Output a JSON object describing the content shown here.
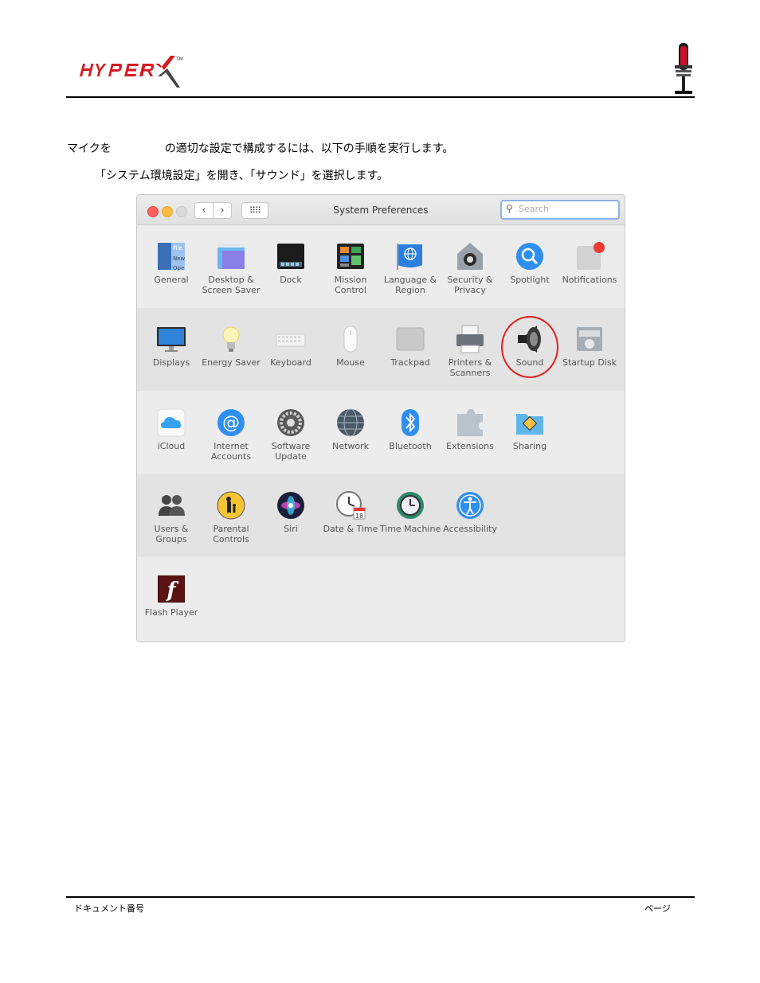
{
  "header": {
    "logo_text": "HyperX",
    "brand_color": "#d71920"
  },
  "instructions": {
    "line1_before": "マイクを",
    "line1_after": "の適切な設定で構成するには、以下の手順を実行します。",
    "line2": "「システム環境設定」を開き、「サウンド」を選択します。"
  },
  "window": {
    "title": "System Preferences",
    "search_placeholder": "Search",
    "back_glyph": "‹",
    "forward_glyph": "›",
    "grid_glyph": "⠿⠿",
    "rows": [
      [
        {
          "label": "General",
          "icon": "general-icon"
        },
        {
          "label": "Desktop & Screen Saver",
          "icon": "desktop-icon"
        },
        {
          "label": "Dock",
          "icon": "dock-icon"
        },
        {
          "label": "Mission Control",
          "icon": "mission-control-icon"
        },
        {
          "label": "Language & Region",
          "icon": "flag-icon"
        },
        {
          "label": "Security & Privacy",
          "icon": "house-lock-icon"
        },
        {
          "label": "Spotlight",
          "icon": "magnifier-icon"
        },
        {
          "label": "Notifications",
          "icon": "notifications-icon"
        }
      ],
      [
        {
          "label": "Displays",
          "icon": "monitor-icon"
        },
        {
          "label": "Energy Saver",
          "icon": "bulb-icon"
        },
        {
          "label": "Keyboard",
          "icon": "keyboard-icon"
        },
        {
          "label": "Mouse",
          "icon": "mouse-icon"
        },
        {
          "label": "Trackpad",
          "icon": "trackpad-icon"
        },
        {
          "label": "Printers & Scanners",
          "icon": "printer-icon"
        },
        {
          "label": "Sound",
          "icon": "speaker-icon"
        },
        {
          "label": "Startup Disk",
          "icon": "disk-icon"
        }
      ],
      [
        {
          "label": "iCloud",
          "icon": "cloud-icon"
        },
        {
          "label": "Internet Accounts",
          "icon": "at-icon"
        },
        {
          "label": "Software Update",
          "icon": "gear-icon"
        },
        {
          "label": "Network",
          "icon": "globe-icon"
        },
        {
          "label": "Bluetooth",
          "icon": "bluetooth-icon"
        },
        {
          "label": "Extensions",
          "icon": "puzzle-icon"
        },
        {
          "label": "Sharing",
          "icon": "sharing-folder-icon"
        }
      ],
      [
        {
          "label": "Users & Groups",
          "icon": "users-icon"
        },
        {
          "label": "Parental Controls",
          "icon": "parental-icon"
        },
        {
          "label": "Siri",
          "icon": "siri-icon"
        },
        {
          "label": "Date & Time",
          "icon": "clock-icon"
        },
        {
          "label": "Time Machine",
          "icon": "time-machine-icon"
        },
        {
          "label": "Accessibility",
          "icon": "accessibility-icon"
        }
      ],
      [
        {
          "label": "Flash Player",
          "icon": "flash-icon"
        }
      ]
    ],
    "calendar_day": "18",
    "general_file_lines": [
      "File",
      "New",
      "Ope"
    ]
  },
  "footer": {
    "left": "ドキュメント番号",
    "right": "ページ"
  }
}
